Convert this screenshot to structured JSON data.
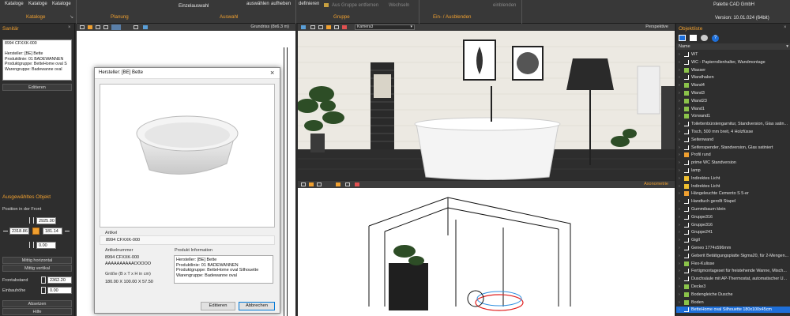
{
  "ribbon": {
    "kataloge_btn1": "Kataloge",
    "kataloge_btn2": "Kataloge",
    "kataloge_btn3": "Kataloge",
    "einzelauswahl": "Einzelauswahl",
    "auswaehlen": "auswählen",
    "aufheben1": "aufheben",
    "definieren": "definieren",
    "aus_gruppe": "Aus Gruppe entfernen",
    "wechseln": "Wechseln",
    "einblenden": "einblenden",
    "company": "Palette CAD GmbH",
    "version": "Version: 10.01.024 (64bit)",
    "groups": [
      "Kataloge",
      "Planung",
      "Auswahl",
      "Gruppe",
      "Ein- / Ausblenden"
    ]
  },
  "left": {
    "sanitaer_title": "Sanitär",
    "info_lines": [
      "8994 CFXXK-000",
      "",
      "Hersteller: [BE] Bette",
      "Produktlinie: 01 BADEWANNEN",
      "Produktgruppe: BetteHome oval S",
      "Warengruppe: Badewanne oval"
    ],
    "editieren": "Editieren",
    "selected_title": "Ausgewähltes Objekt",
    "position_label": "Position in der Front",
    "val_top": "2925.00",
    "val_left": "2318.86",
    "val_right": "181.14",
    "val_bottom": "0.00",
    "mittig_h": "Mittig horizontal",
    "mittig_v": "Mittig vertikal",
    "frontabstand_label": "Frontabstand",
    "frontabstand_val": "2362.20",
    "einbauhoehe_label": "Einbauhöhe",
    "einbauhoehe_val": "0.00",
    "absetzen": "Absetzen",
    "hilfe": "Hilfe"
  },
  "plan": {
    "view_label": "Grundriss (8x6.3 m)"
  },
  "dialog": {
    "title": "Hersteller: [BE] Bette",
    "artikel_label": "Artikel",
    "artikel_val": "8994 CFXXK-000",
    "artikelnummer_label": "Artikelnummer",
    "artikelnummer_val1": "8994 CFXXK-000",
    "artikelnummer_val2": "AAAAAAAAAAOOOOO",
    "groesse_label": "Größe (B x T x H in cm)",
    "groesse_val": "180.00 X 100.00 X 57.50",
    "produktinfo_label": "Produkt Information",
    "produktinfo_lines": [
      "Hersteller: [BE] Bette",
      "Produktlinie: 01 BADEWANNEN",
      "Produktgruppe: BetteHome oval Silhouette",
      "Warengruppe: Badewanne oval"
    ],
    "editieren": "Editieren",
    "abbrechen": "Abbrechen"
  },
  "persp": {
    "camera": "Kamera3",
    "view_label": "Perspektive"
  },
  "axo": {
    "view_label": "Axonometrie"
  },
  "right": {
    "title": "Objektliste",
    "column": "Name",
    "items": [
      {
        "label": "WT",
        "icon": "object-icon",
        "color": "#ffffff"
      },
      {
        "label": "WC - Papierrollenhalter, Wandmontage",
        "icon": "object-icon",
        "color": "#ffffff"
      },
      {
        "label": "Wasser",
        "icon": "material-icon",
        "color": "#8bc34a"
      },
      {
        "label": "Wandhaken",
        "icon": "object-icon",
        "color": "#ffffff"
      },
      {
        "label": "Wand4",
        "icon": "wall-icon",
        "color": "#8bc34a"
      },
      {
        "label": "Wand3",
        "icon": "wall-icon",
        "color": "#8bc34a"
      },
      {
        "label": "Wand23",
        "icon": "wall-icon",
        "color": "#8bc34a"
      },
      {
        "label": "Wand1",
        "icon": "wall-icon",
        "color": "#8bc34a"
      },
      {
        "label": "Vorwand1",
        "icon": "wall-icon",
        "color": "#8bc34a"
      },
      {
        "label": "Toilettenbürstengarnitur, Standversion, Glas satin...",
        "icon": "object-icon",
        "color": "#ffffff"
      },
      {
        "label": "Tisch, 500 mm breit, 4 Holzfüsse",
        "icon": "object-icon",
        "color": "#ffffff"
      },
      {
        "label": "Seitenwand",
        "icon": "object-icon",
        "color": "#ffffff"
      },
      {
        "label": "Seifenspender, Standversion, Glas satiniert",
        "icon": "object-icon",
        "color": "#ffffff"
      },
      {
        "label": "Profil rund",
        "icon": "profile-icon",
        "color": "#f0a030"
      },
      {
        "label": "prime WC Standversion",
        "icon": "object-icon",
        "color": "#ffffff"
      },
      {
        "label": "lamp",
        "icon": "object-icon",
        "color": "#ffffff"
      },
      {
        "label": "Indirektes Licht",
        "icon": "light-icon",
        "color": "#f0c030"
      },
      {
        "label": "Indirektes Licht",
        "icon": "light-icon",
        "color": "#f0c030"
      },
      {
        "label": "Hängeleuchte Cemento S 5-er",
        "icon": "group-icon",
        "color": "#f0a030"
      },
      {
        "label": "Handtuch gerollt Stapel",
        "icon": "object-icon",
        "color": "#ffffff"
      },
      {
        "label": "Gummibaum klein",
        "icon": "object-icon",
        "color": "#ffffff"
      },
      {
        "label": "Gruppe316",
        "icon": "object-icon",
        "color": "#ffffff"
      },
      {
        "label": "Gruppe316",
        "icon": "object-icon",
        "color": "#ffffff"
      },
      {
        "label": "Gruppe241",
        "icon": "object-icon",
        "color": "#ffffff"
      },
      {
        "label": "Gigll",
        "icon": "object-icon",
        "color": "#ffffff"
      },
      {
        "label": "Geneo 1774x596mm",
        "icon": "object-icon",
        "color": "#ffffff"
      },
      {
        "label": "Geberit Betätigungsplatte Sigma20, für 2-Mengen...",
        "icon": "object-icon",
        "color": "#ffffff"
      },
      {
        "label": "Flex-Kulisse",
        "icon": "material-icon",
        "color": "#8bc34a"
      },
      {
        "label": "Fertigmontageset für freistehende Wanne, Misch...",
        "icon": "object-icon",
        "color": "#ffffff"
      },
      {
        "label": "Duschsäule mit AP-Thermostat, automatischer U...",
        "icon": "object-icon",
        "color": "#ffffff"
      },
      {
        "label": "Decke3",
        "icon": "wall-icon",
        "color": "#8bc34a"
      },
      {
        "label": "Bodengleiche Dusche",
        "icon": "material-icon",
        "color": "#8bc34a"
      },
      {
        "label": "Boden",
        "icon": "wall-icon",
        "color": "#8bc34a"
      },
      {
        "label": "BetteHome oval Silhouette 180x100x45cm",
        "icon": "object-icon",
        "color": "#ffffff",
        "selected": true
      }
    ]
  }
}
